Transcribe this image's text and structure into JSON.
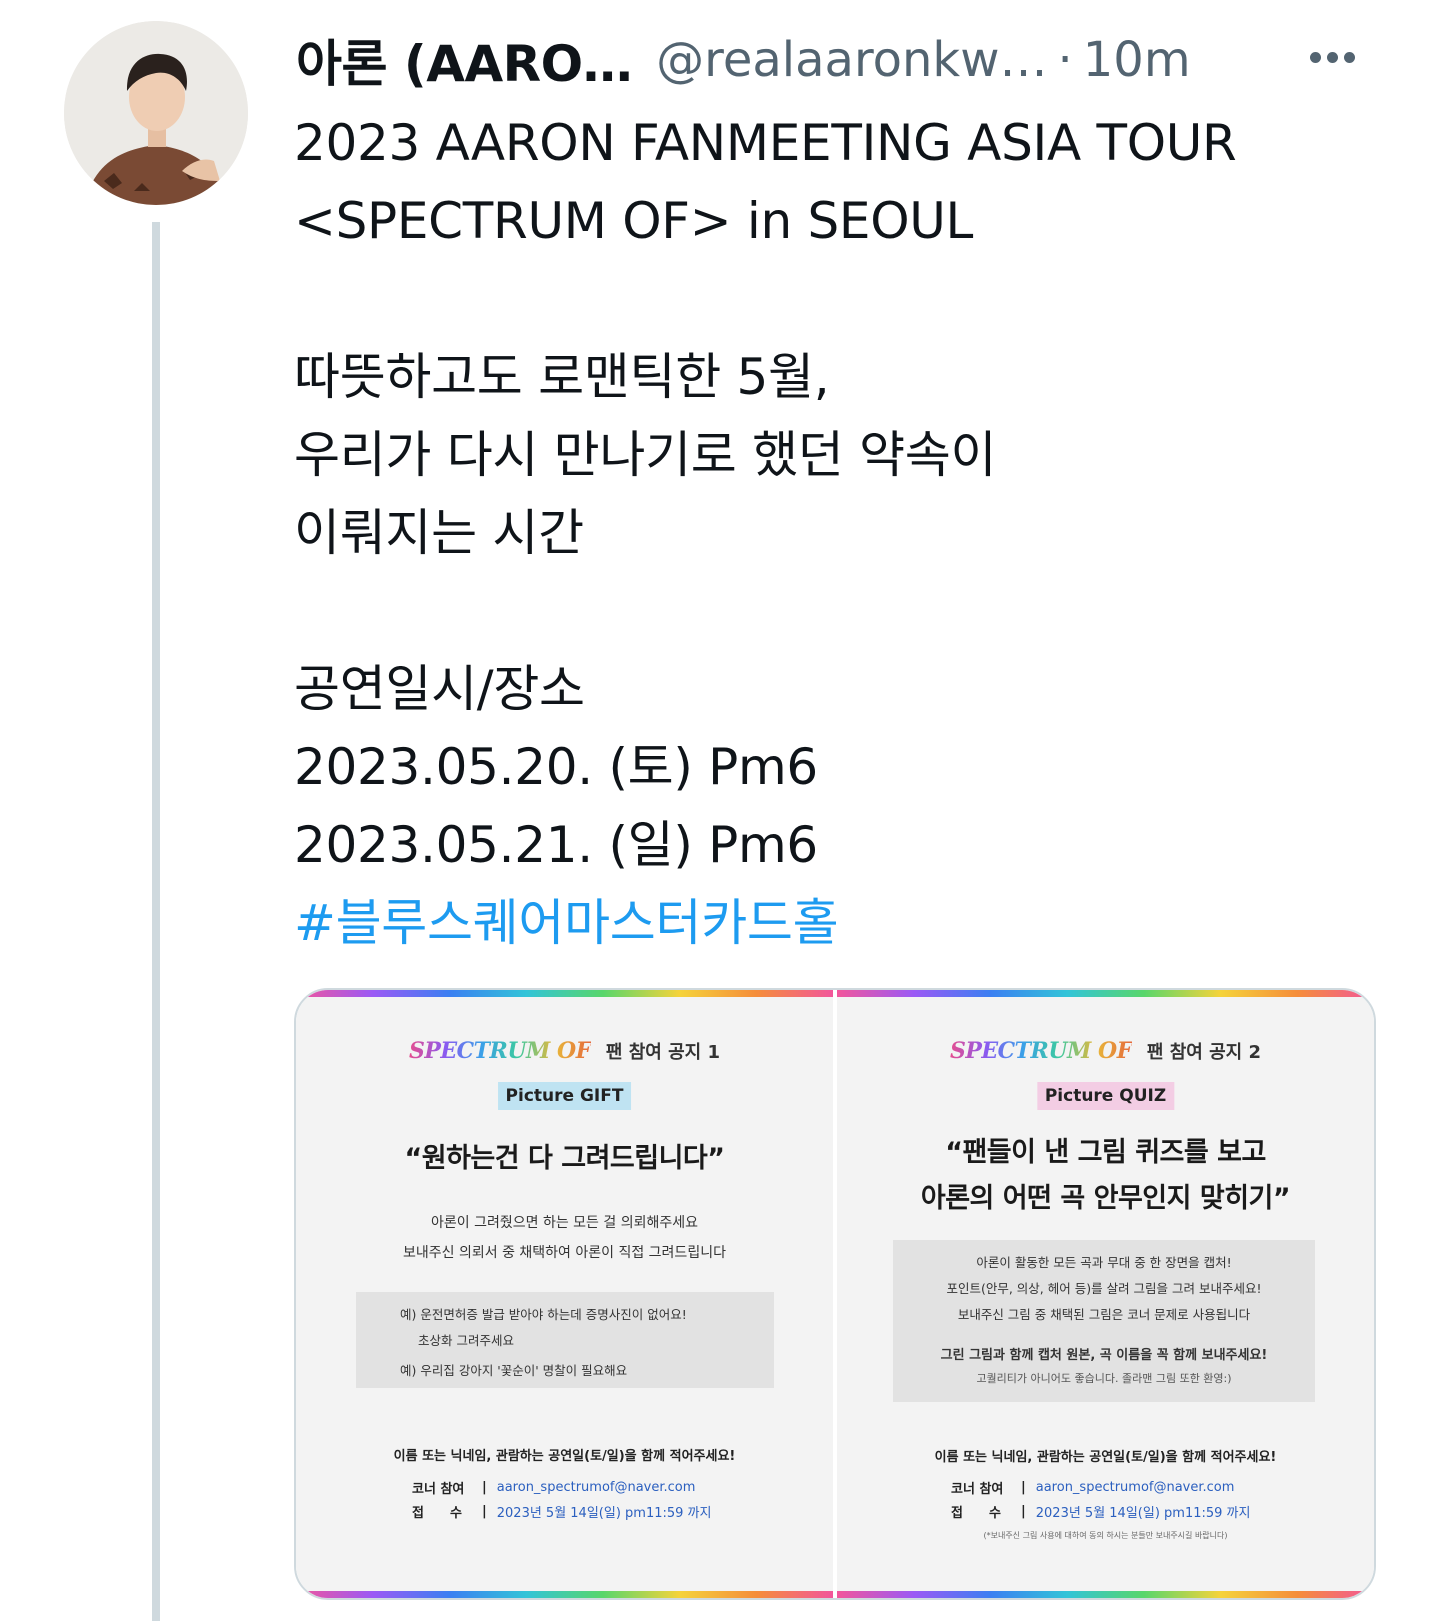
{
  "author": {
    "display_name": "아론 (AARO…",
    "handle": "@realaaronkw…",
    "separator": "·",
    "time": "10m"
  },
  "tweet": {
    "lines": [
      "2023 AARON FANMEETING ASIA TOUR",
      "<SPECTRUM OF> in SEOUL",
      "",
      "따뜻하고도 로맨틱한 5월,",
      "우리가 다시 만나기로 했던 약속이",
      "이뤄지는 시간",
      "",
      "공연일시/장소",
      "2023.05.20. (토) Pm6",
      "2023.05.21. (일) Pm6"
    ],
    "hashtag": "#블루스퀘어마스터카드홀"
  },
  "media": {
    "left": {
      "logo": "SPECTRUM OF",
      "title": "팬 참여 공지 1",
      "tag": "Picture GIFT",
      "headline": "“원하는건 다 그려드립니다”",
      "desc": [
        "아론이 그려줬으면 하는 모든 걸 의뢰해주세요",
        "보내주신 의뢰서 중 채택하여 아론이 직접 그려드립니다"
      ],
      "examples": [
        "예) 운전면허증 발급 받아야 하는데 증명사진이 없어요!",
        "초상화 그려주세요",
        "예) 우리집 강아지 '꽃순이' 명찰이 필요해요"
      ],
      "footer": "이름 또는 닉네임, 관람하는 공연일(토/일)을 함께 적어주세요!",
      "corner_label": "코너 참여",
      "email": "aaron_spectrumof@naver.com",
      "deadline_label": "접　　수",
      "deadline": "2023년 5월 14일(일) pm11:59 까지"
    },
    "right": {
      "logo": "SPECTRUM OF",
      "title": "팬 참여 공지 2",
      "tag": "Picture QUIZ",
      "headline_1": "“팬들이 낸 그림 퀴즈를 보고",
      "headline_2": "아론의 어떤 곡 안무인지 맞히기”",
      "box_lines": [
        "아론이 활동한 모든 곡과 무대 중 한 장면을 캡처!",
        "포인트(안무, 의상, 헤어 등)를 살려 그림을 그려 보내주세요!",
        "보내주신 그림 중 채택된 그림은 코너 문제로 사용됩니다"
      ],
      "box_bold": "그린 그림과 함께 캡처 원본, 곡 이름을 꼭 함께 보내주세요!",
      "box_small": "고퀄리티가 아니어도 좋습니다. 졸라맨 그림 또한 환영:)",
      "footer": "이름 또는 닉네임, 관람하는 공연일(토/일)을 함께 적어주세요!",
      "corner_label": "코너 참여",
      "email": "aaron_spectrumof@naver.com",
      "deadline_label": "접　　수",
      "deadline": "2023년 5월 14일(일) pm11:59 까지",
      "disclaimer": "(*보내주신 그림 사용에 대하여 동의 하시는 분들만 보내주시길 바랍니다)"
    }
  }
}
